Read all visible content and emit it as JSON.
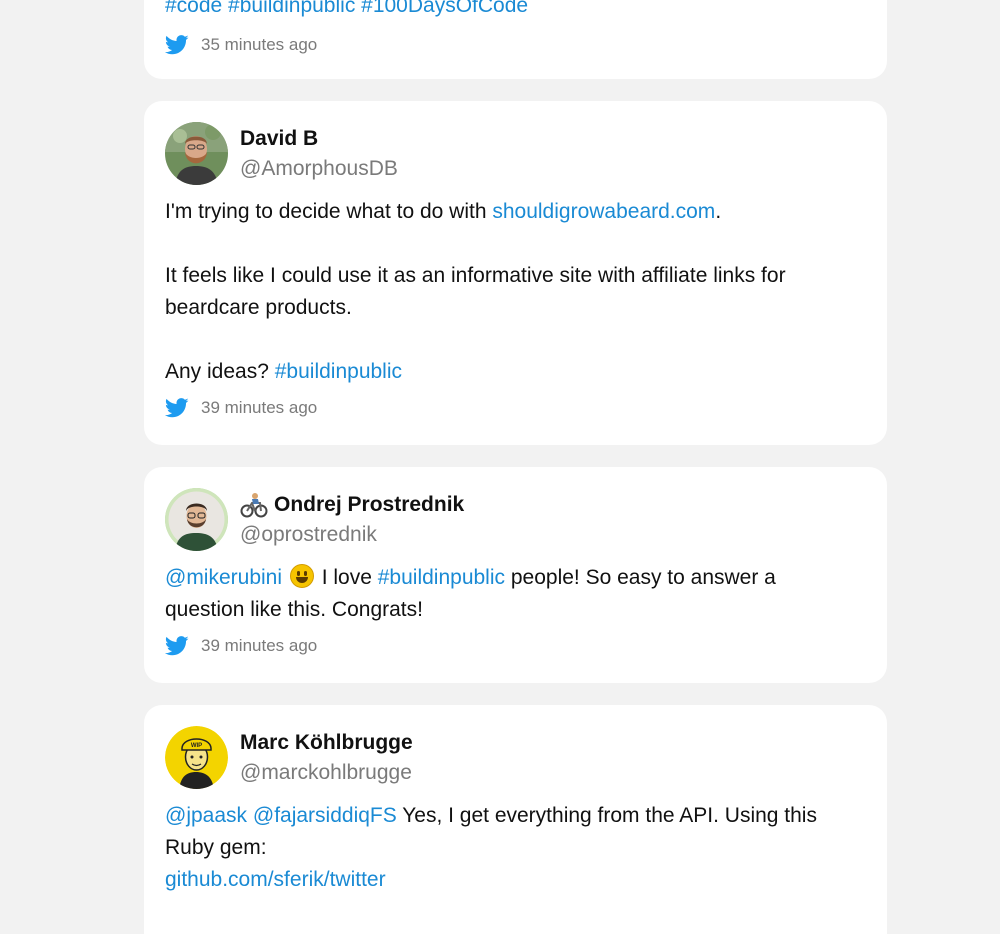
{
  "tweets": [
    {
      "body_text": "#code #buildinpublic #100DaysOfCode",
      "time": "35 minutes ago"
    },
    {
      "name": "David B",
      "handle": "@AmorphousDB",
      "line1_pre": "I'm trying to decide what to do with ",
      "line1_link": "shouldigrowabeard.com",
      "line1_post": ".",
      "para2": "It feels like I could use it as an informative site with affiliate links for beardcare products.",
      "line3_pre": "Any ideas? ",
      "line3_tag": "#buildinpublic",
      "time": "39 minutes ago"
    },
    {
      "name": "Ondrej Prostrednik",
      "name_emoji": "🚵",
      "handle": "@oprostrednik",
      "mention": "@mikerubini",
      "text_a": " I love ",
      "tag": "#buildinpublic",
      "text_b": " people! So easy to answer a question like this. Congrats!",
      "time": "39 minutes ago"
    },
    {
      "name": "Marc Köhlbrugge",
      "handle": "@marckohlbrugge",
      "mention1": "@jpaask",
      "mention2": "@fajarsiddiqFS",
      "text": " Yes, I get everything from the API. Using this Ruby gem:",
      "link": "github.com/sferik/twitter"
    }
  ],
  "colors": {
    "link": "#1a8ad4",
    "twitter_blue": "#1d9bf0",
    "background": "#f2f2f2"
  },
  "icons": {
    "source": "twitter-bird-icon",
    "reaction": "smiley-emoji-icon"
  }
}
